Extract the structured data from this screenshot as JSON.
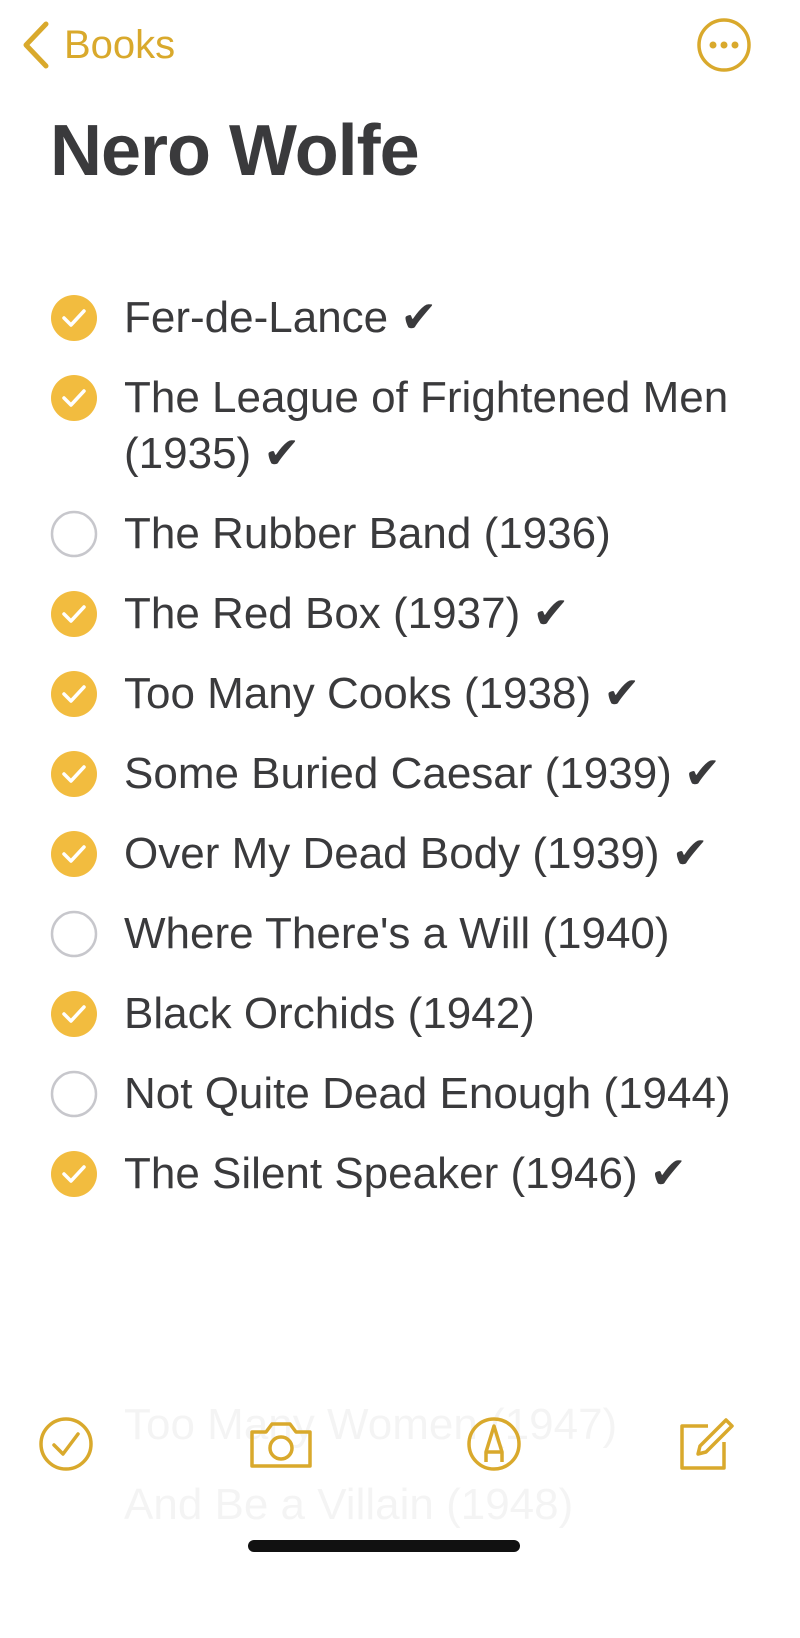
{
  "nav": {
    "back_label": "Books"
  },
  "note": {
    "title": "Nero Wolfe"
  },
  "checklist": [
    {
      "text": "Fer-de-Lance ✔",
      "checked": true
    },
    {
      "text": "The League of Frightened Men (1935) ✔",
      "checked": true
    },
    {
      "text": "The Rubber Band (1936)",
      "checked": false
    },
    {
      "text": "The Red Box (1937) ✔",
      "checked": true
    },
    {
      "text": "Too Many Cooks (1938) ✔",
      "checked": true
    },
    {
      "text": "Some Buried Caesar (1939) ✔",
      "checked": true
    },
    {
      "text": "Over My Dead Body (1939) ✔",
      "checked": true
    },
    {
      "text": "Where There's a Will (1940)",
      "checked": false
    },
    {
      "text": "Black Orchids (1942)",
      "checked": true
    },
    {
      "text": "Not Quite Dead Enough (1944)",
      "checked": false
    },
    {
      "text": "The Silent Speaker (1946) ✔",
      "checked": true
    }
  ],
  "hidden_under_toolbar": [
    "Too Many Women (1947)",
    "And Be a Villain (1948)"
  ],
  "toolbar": {
    "icons": [
      "checklist-icon",
      "camera-icon",
      "markup-icon",
      "compose-icon"
    ]
  },
  "colors": {
    "accent": "#d9a92c",
    "checked_fill": "#f2bc3f",
    "unchecked_stroke": "#c7c7cc",
    "text": "#3a3a3c"
  }
}
